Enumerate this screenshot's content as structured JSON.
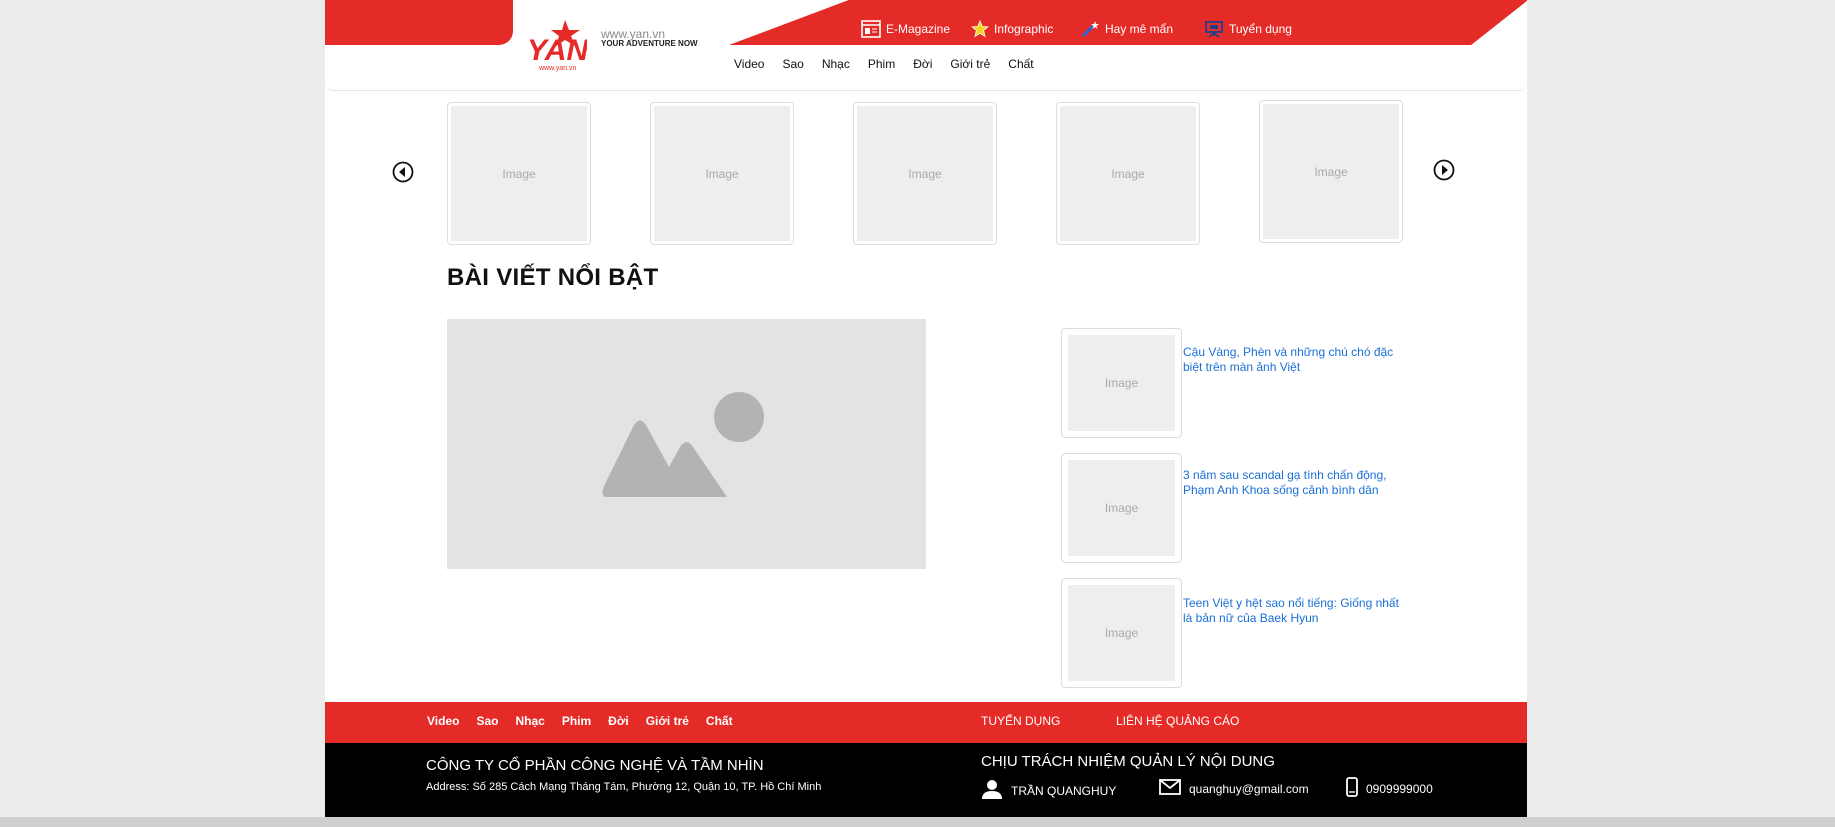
{
  "header": {
    "logo_text": "YAN",
    "logo_url": "www.yan.vn",
    "site_url": "www.yan.vn",
    "slogan": "YOUR ADVENTURE NOW",
    "top_links": [
      {
        "label": "E-Magazine",
        "icon": "magazine-icon"
      },
      {
        "label": "Infographic",
        "icon": "star-icon"
      },
      {
        "label": "Hay mê mẩn",
        "icon": "magic-wand-icon"
      },
      {
        "label": "Tuyển dụng",
        "icon": "presentation-board-icon"
      }
    ],
    "main_nav": [
      "Video",
      "Sao",
      "Nhạc",
      "Phim",
      "Đời",
      "Giới trẻ",
      "Chất"
    ]
  },
  "carousel": {
    "items": [
      "Image",
      "Image",
      "Image",
      "Image",
      "Image"
    ],
    "prev_icon": "arrow-left-circle-icon",
    "next_icon": "arrow-right-circle-icon"
  },
  "featured": {
    "title": "BÀI VIẾT NỔI BẬT",
    "hero_icon": "image-placeholder-icon",
    "side_articles": [
      {
        "image": "Image",
        "title": "Cậu Vàng, Phèn và những chú chó đặc biệt trên màn ảnh Việt"
      },
      {
        "image": "Image",
        "title": "3 năm sau scandal gạ tình chấn động, Phạm Anh Khoa sống cảnh bình dân"
      },
      {
        "image": "Image",
        "title": "Teen Việt y hệt sao nổi tiếng: Giống nhất là bản nữ của Baek Hyun"
      }
    ]
  },
  "footer": {
    "nav": [
      "Video",
      "Sao",
      "Nhạc",
      "Phim",
      "Đời",
      "Giới trẻ",
      "Chất"
    ],
    "recruit_label": "TUYỂN DỤNG",
    "ads_label": "LIÊN HỆ QUẢNG CÁO",
    "company": "CÔNG TY CỔ PHẦN CÔNG NGHỆ VÀ TẦM NHÌN",
    "address": "Address: Số 285 Cách Mạng Tháng Tám, Phường 12, Quận 10, TP. Hồ Chí Minh",
    "responsibility_title": "CHỊU TRÁCH NHIỆM QUẢN LÝ NỘI DUNG",
    "person": "TRẦN QUANGHUY",
    "email": "quanghuy@gmail.com",
    "phone": "0909999000"
  },
  "colors": {
    "brand_red": "#e52b27",
    "link_blue": "#1a6fd6",
    "footer_black": "#000000"
  }
}
